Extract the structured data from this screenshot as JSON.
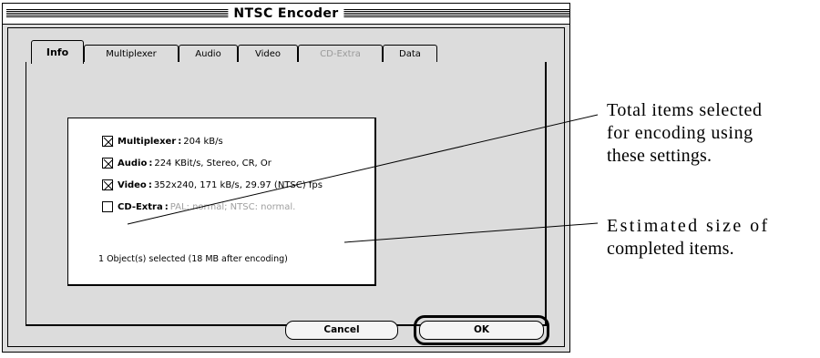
{
  "window": {
    "title": "NTSC Encoder"
  },
  "tabs": [
    {
      "label": "Info",
      "active": true,
      "enabled": true
    },
    {
      "label": "Multiplexer",
      "active": false,
      "enabled": true
    },
    {
      "label": "Audio",
      "active": false,
      "enabled": true
    },
    {
      "label": "Video",
      "active": false,
      "enabled": true
    },
    {
      "label": "CD-Extra",
      "active": false,
      "enabled": false
    },
    {
      "label": "Data",
      "active": false,
      "enabled": true
    }
  ],
  "info": {
    "options": [
      {
        "name": "Multiplexer",
        "value": "204 kB/s",
        "checked": true,
        "enabled": true
      },
      {
        "name": "Audio",
        "value": "224 KBit/s, Stereo, CR, Or",
        "checked": true,
        "enabled": true
      },
      {
        "name": "Video",
        "value": "352x240, 171 kB/s, 29.97 (NTSC) fps",
        "checked": true,
        "enabled": true
      },
      {
        "name": "CD-Extra",
        "value": "PAL: normal; NTSC: normal.",
        "checked": false,
        "enabled": false
      }
    ],
    "status": "1 Object(s) selected (18 MB after encoding)"
  },
  "buttons": {
    "cancel": "Cancel",
    "ok": "OK"
  },
  "annotations": {
    "items_selected": [
      "Total items selected",
      "for encoding using",
      "these settings."
    ],
    "estimated_size": [
      "Estimated size of",
      "completed items."
    ]
  }
}
